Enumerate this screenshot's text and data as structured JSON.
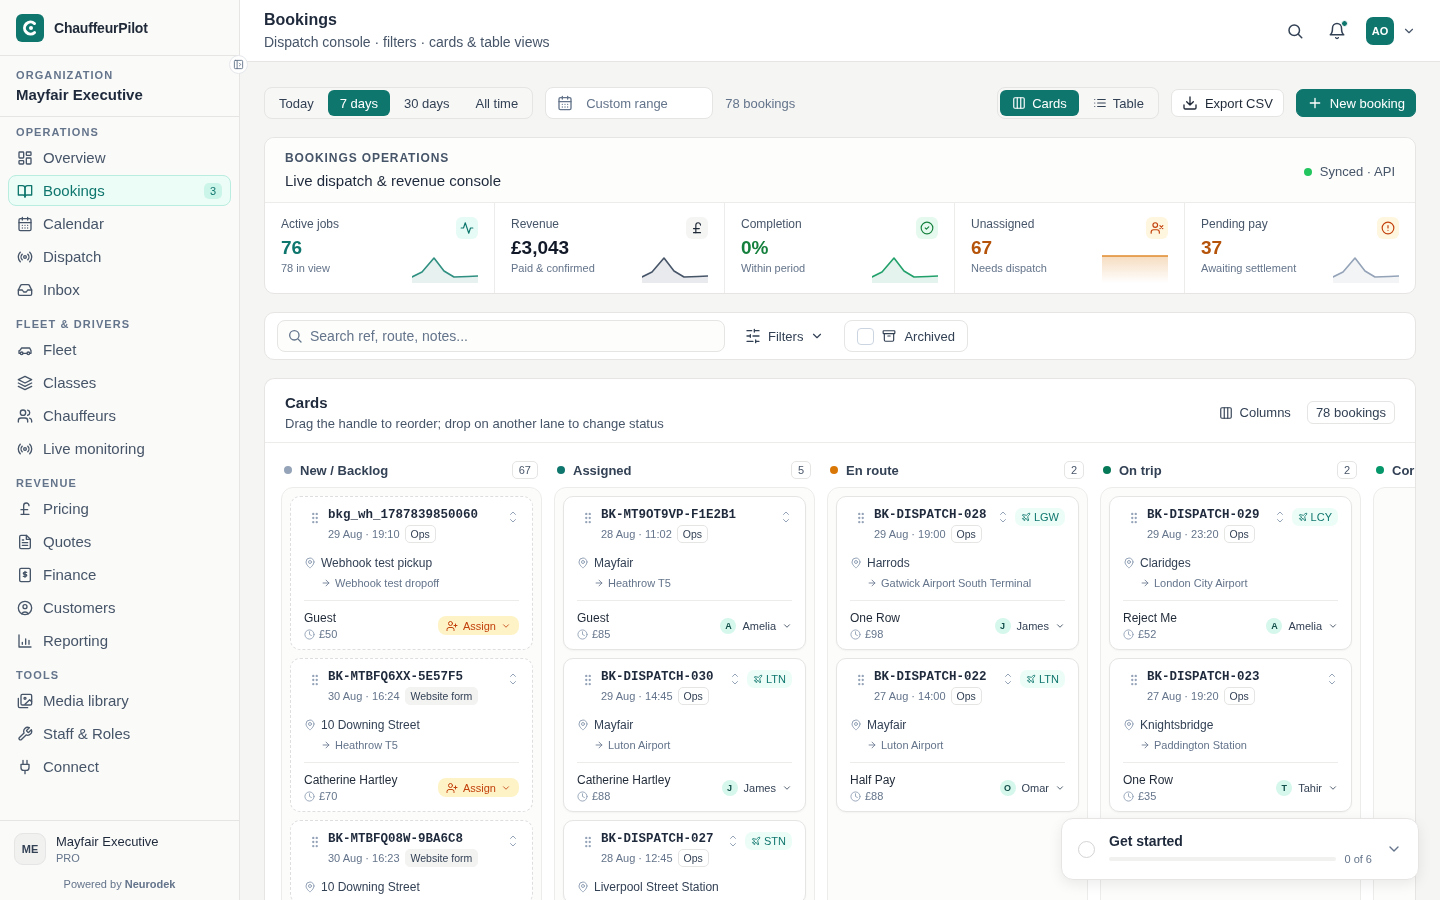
{
  "sidebar": {
    "brand": "ChauffeurPilot",
    "org_label": "ORGANIZATION",
    "org_name": "Mayfair Executive",
    "sections": [
      {
        "title": "OPERATIONS",
        "items": [
          {
            "label": "Overview",
            "selected": false
          },
          {
            "label": "Bookings",
            "selected": true,
            "badge": "3"
          },
          {
            "label": "Calendar",
            "selected": false
          },
          {
            "label": "Dispatch",
            "selected": false
          },
          {
            "label": "Inbox",
            "selected": false
          }
        ]
      },
      {
        "title": "FLEET & DRIVERS",
        "items": [
          {
            "label": "Fleet",
            "selected": false
          },
          {
            "label": "Classes",
            "selected": false
          },
          {
            "label": "Chauffeurs",
            "selected": false
          },
          {
            "label": "Live monitoring",
            "selected": false
          }
        ]
      },
      {
        "title": "REVENUE",
        "items": [
          {
            "label": "Pricing",
            "selected": false
          },
          {
            "label": "Quotes",
            "selected": false
          },
          {
            "label": "Finance",
            "selected": false
          },
          {
            "label": "Customers",
            "selected": false
          },
          {
            "label": "Reporting",
            "selected": false
          }
        ]
      },
      {
        "title": "TOOLS",
        "items": [
          {
            "label": "Media library",
            "selected": false
          },
          {
            "label": "Staff & Roles",
            "selected": false
          },
          {
            "label": "Connect",
            "selected": false
          }
        ]
      }
    ],
    "account": {
      "initials": "ME",
      "name": "Mayfair Executive",
      "plan": "PRO"
    },
    "footer": "Powered by **Neurodek**"
  },
  "header": {
    "title": "Bookings",
    "subtitle": "Dispatch console · filters · cards & table views",
    "notifications_unread": true,
    "avatar": "AO"
  },
  "toolbar": {
    "ranges": [
      {
        "label": "Today",
        "selected": false
      },
      {
        "label": "7 days",
        "selected": true
      },
      {
        "label": "30 days",
        "selected": false
      },
      {
        "label": "All time",
        "selected": false
      }
    ],
    "date_field": {
      "placeholder": "Custom range"
    },
    "count": "78 bookings",
    "views": [
      {
        "label": "Cards",
        "selected": true
      },
      {
        "label": "Table",
        "selected": false
      }
    ],
    "export": "Export CSV",
    "new": "New booking"
  },
  "operations": {
    "eyebrow": "BOOKINGS OPERATIONS",
    "title": "Live dispatch & revenue console",
    "sync": "Synced · API",
    "kpis": [
      {
        "label": "Active jobs",
        "value": "76",
        "sub": "78 in view",
        "color": "#0f766e",
        "kind": "peak"
      },
      {
        "label": "Revenue",
        "value": "£3,043",
        "sub": "Paid & confirmed",
        "color": "#111827",
        "kind": "peak"
      },
      {
        "label": "Completion",
        "value": "0%",
        "sub": "Within period",
        "color": "#15803d",
        "kind": "peak"
      },
      {
        "label": "Unassigned",
        "value": "67",
        "sub": "Needs dispatch",
        "color": "#b45309",
        "kind": "flat"
      },
      {
        "label": "Pending pay",
        "value": "37",
        "sub": "Awaiting settlement",
        "color": "#b45309",
        "kind": "peak"
      }
    ]
  },
  "filters": {
    "search": {
      "placeholder": "Search ref, route, notes..."
    },
    "filters_button": "Filters",
    "archived": {
      "label": "Archived",
      "checked": false
    }
  },
  "board": {
    "title": "Cards",
    "subtitle": "Drag the handle to reorder; drop on another lane to change status",
    "columns_button": "Columns",
    "count": "78 bookings",
    "lanes": [
      {
        "name": "New / Backlog",
        "count": "67",
        "color": "#94a3b8",
        "cards": [
          {
            "kind": "unassigned",
            "ref": "bkg_wh_1787839850060",
            "when": "29 Aug · 19:10",
            "source": {
              "label": "Ops",
              "kind": "outline"
            },
            "pickup": "Webhook test pickup",
            "dropoff": "Webhook test dropoff",
            "customer": "Guest",
            "price": "£50",
            "assign": "Assign"
          },
          {
            "kind": "unassigned",
            "ref": "BK-MTBFQ6XX-5E57F5",
            "when": "30 Aug · 16:24",
            "source": {
              "label": "Website form",
              "kind": "filled"
            },
            "pickup": "10 Downing Street",
            "dropoff": "Heathrow T5",
            "customer": "Catherine Hartley",
            "price": "£70",
            "assign": "Assign"
          },
          {
            "kind": "unassigned",
            "ref": "BK-MTBFQ08W-9BA6C8",
            "when": "30 Aug · 16:23",
            "source": {
              "label": "Website form",
              "kind": "filled"
            },
            "pickup": "10 Downing Street"
          }
        ]
      },
      {
        "name": "Assigned",
        "count": "5",
        "color": "#0f766e",
        "cards": [
          {
            "kind": "assigned",
            "ref": "BK-MT9OT9VP-F1E2B1",
            "when": "28 Aug · 11:02",
            "source": {
              "label": "Ops",
              "kind": "outline"
            },
            "pickup": "Mayfair",
            "dropoff": "Heathrow T5",
            "customer": "Guest",
            "price": "£85",
            "driver": {
              "initial": "A",
              "name": "Amelia"
            }
          },
          {
            "kind": "assigned",
            "ref": "BK-DISPATCH-030",
            "when": "29 Aug · 14:45",
            "source": {
              "label": "Ops",
              "kind": "outline"
            },
            "airport": "LTN",
            "pickup": "Mayfair",
            "dropoff": "Luton Airport",
            "customer": "Catherine Hartley",
            "price": "£88",
            "driver": {
              "initial": "J",
              "name": "James"
            }
          },
          {
            "kind": "assigned",
            "ref": "BK-DISPATCH-027",
            "when": "28 Aug · 12:45",
            "source": {
              "label": "Ops",
              "kind": "outline"
            },
            "airport": "STN",
            "pickup": "Liverpool Street Station"
          }
        ]
      },
      {
        "name": "En route",
        "count": "2",
        "color": "#d97706",
        "cards": [
          {
            "kind": "assigned",
            "ref": "BK-DISPATCH-028",
            "when": "29 Aug · 19:00",
            "source": {
              "label": "Ops",
              "kind": "outline"
            },
            "airport": "LGW",
            "pickup": "Harrods",
            "dropoff": "Gatwick Airport South Terminal",
            "customer": "One Row",
            "price": "£98",
            "driver": {
              "initial": "J",
              "name": "James"
            }
          },
          {
            "kind": "assigned",
            "ref": "BK-DISPATCH-022",
            "when": "27 Aug · 14:00",
            "source": {
              "label": "Ops",
              "kind": "outline"
            },
            "airport": "LTN",
            "pickup": "Mayfair",
            "dropoff": "Luton Airport",
            "customer": "Half Pay",
            "price": "£88",
            "driver": {
              "initial": "O",
              "name": "Omar"
            }
          }
        ]
      },
      {
        "name": "On trip",
        "count": "2",
        "color": "#047857",
        "cards": [
          {
            "kind": "assigned",
            "ref": "BK-DISPATCH-029",
            "when": "29 Aug · 23:20",
            "source": {
              "label": "Ops",
              "kind": "outline"
            },
            "airport": "LCY",
            "pickup": "Claridges",
            "dropoff": "London City Airport",
            "customer": "Reject Me",
            "price": "£52",
            "driver": {
              "initial": "A",
              "name": "Amelia"
            }
          },
          {
            "kind": "assigned",
            "ref": "BK-DISPATCH-023",
            "when": "27 Aug · 19:20",
            "source": {
              "label": "Ops",
              "kind": "outline"
            },
            "pickup": "Knightsbridge",
            "dropoff": "Paddington Station",
            "customer": "One Row",
            "price": "£35",
            "driver": {
              "initial": "T",
              "name": "Tahir"
            }
          }
        ]
      },
      {
        "name": "Cor",
        "color": "#059669"
      }
    ]
  },
  "onboarding": {
    "title": "Get started",
    "done": false,
    "level": 0,
    "progress": "0 of 6"
  }
}
